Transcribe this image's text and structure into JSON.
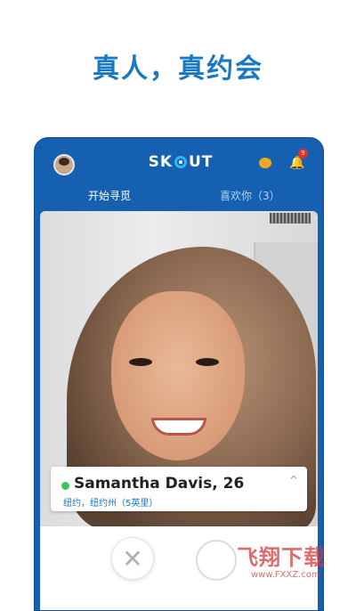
{
  "headline": "真人，真约会",
  "app": {
    "logo_text_left": "SK",
    "logo_text_right": "UT",
    "icons": {
      "profile": "avatar-icon",
      "crown": "crown-icon",
      "notifications": "bell-icon"
    },
    "notification_badge": "9"
  },
  "tabs": [
    {
      "label": "开始寻觅"
    },
    {
      "label": "喜欢你（3）"
    }
  ],
  "profile_card": {
    "name": "Samantha Davis, 26",
    "location": "纽约，纽约州（5英里）",
    "online": true
  },
  "actions": {
    "pass_symbol": "✕"
  },
  "watermark": {
    "brand": "飞翔下载",
    "url": "www.FXXZ.com"
  },
  "colors": {
    "brand_blue": "#1560b0",
    "headline_blue": "#1a78c2",
    "online_green": "#3cc35a"
  }
}
